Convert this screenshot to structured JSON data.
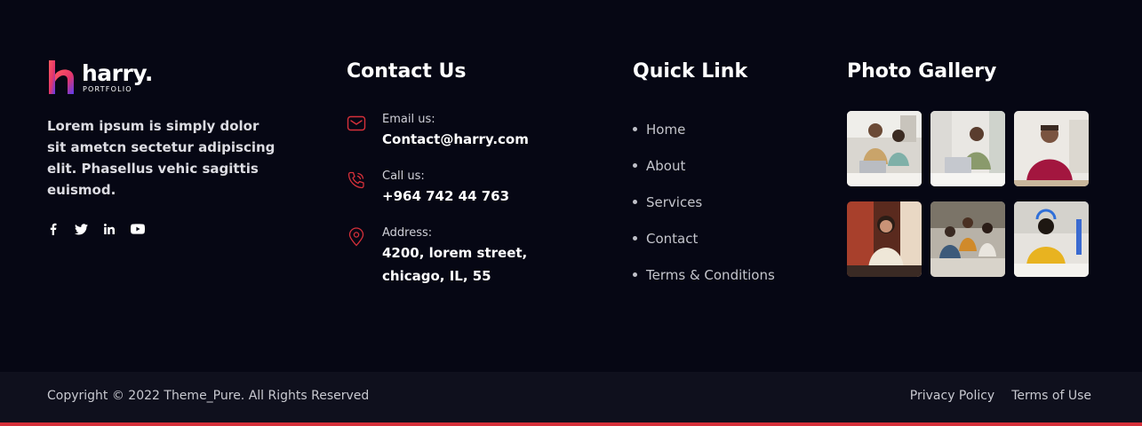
{
  "brand": {
    "name": "harry.",
    "tagline": "PORTFOLIO",
    "description": "Lorem ipsum is simply dolor sit ametcn sectetur adipiscing elit. Phasellus vehic sagittis euismod.",
    "socials": [
      "facebook-icon",
      "twitter-icon",
      "linkedin-icon",
      "youtube-icon"
    ]
  },
  "contact": {
    "title": "Contact Us",
    "email_label": "Email us:",
    "email_value": "Contact@harry.com",
    "phone_label": "Call us:",
    "phone_value": "+964 742 44 763",
    "address_label": "Address:",
    "address_line1": "4200, lorem street,",
    "address_line2": "chicago, IL, 55"
  },
  "quick_links": {
    "title": "Quick Link",
    "items": [
      "Home",
      "About",
      "Services",
      "Contact",
      "Terms & Conditions"
    ]
  },
  "gallery": {
    "title": "Photo Gallery",
    "photos": [
      "photo-1",
      "photo-2",
      "photo-3",
      "photo-4",
      "photo-5",
      "photo-6"
    ]
  },
  "bottom": {
    "copyright": "Copyright © 2022 Theme_Pure. All Rights Reserved",
    "privacy": "Privacy Policy",
    "terms": "Terms of Use"
  },
  "colors": {
    "background": "#060714",
    "bottom_bar": "#0f101d",
    "accent": "#d6303a"
  }
}
